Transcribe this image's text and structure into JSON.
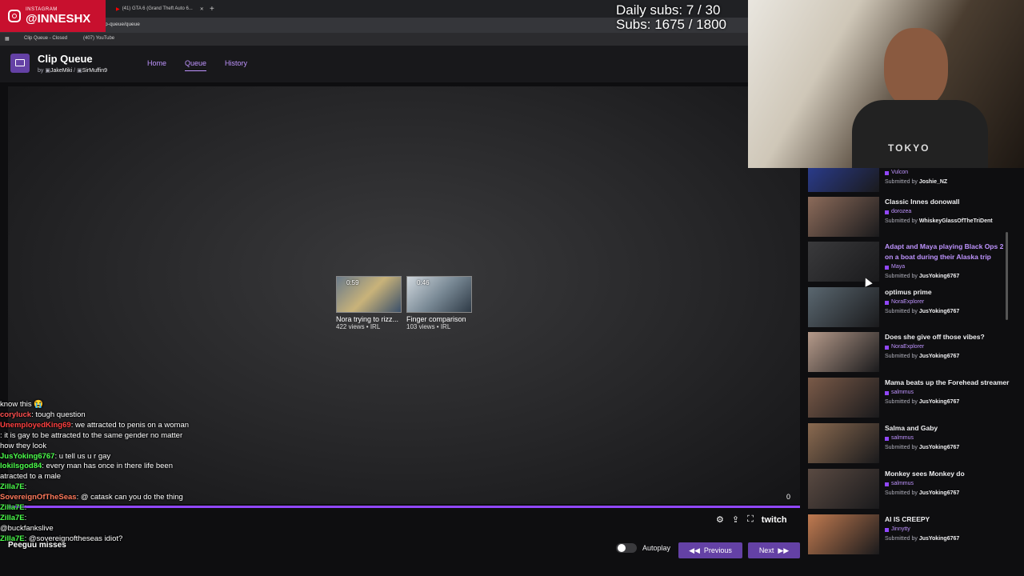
{
  "browser": {
    "tabs": [
      "(41) GTA 6 (Grand Theft Auto 6..."
    ],
    "url": "ch-clip-queue/queue",
    "bookmarks": [
      "Clip Queue - Closed",
      "(407) YouTube"
    ]
  },
  "instagram_badge": {
    "label": "INSTAGRAM",
    "handle": "@INNESHX"
  },
  "stream_stats": {
    "daily_subs": "Daily subs: 7 / 30",
    "subs": "Subs: 1675 / 1800"
  },
  "app": {
    "title": "Clip Queue",
    "by_label": "by",
    "authors": [
      "JakeMiki",
      "SirMuffin9"
    ],
    "nav": [
      "Home",
      "Queue",
      "History"
    ]
  },
  "player": {
    "related": [
      {
        "duration": "0:59",
        "title": "Nora trying to rizz...",
        "meta": "422 views • IRL"
      },
      {
        "duration": "0:46",
        "title": "Finger comparison",
        "meta": "103 views • IRL"
      }
    ],
    "count": "0",
    "progress": 1.0,
    "brand": "twitch",
    "autoplay_label": "Autoplay",
    "autoplay_on": false,
    "previous_label": "Previous",
    "next_label": "Next"
  },
  "chat": [
    {
      "user": "",
      "text": "know this 😭",
      "color": "#ffffff"
    },
    {
      "user": "coryluck",
      "text": ": tough question",
      "color": "#ff4f4f"
    },
    {
      "user": "UnemployedKing69",
      "text": ": we attracted to penis on a woman",
      "color": "#ff4040"
    },
    {
      "user": "",
      "text": ": it is gay to be attracted to the same gender no matter how they look",
      "color": "#3f6bff"
    },
    {
      "user": "JusYoking6767",
      "text": ": u tell us u r gay",
      "color": "#4cff4c"
    },
    {
      "user": "lokilsgod84",
      "text": ": every man has once in there life been atracted to a male",
      "color": "#4cff4c"
    },
    {
      "user": "Zilla7E",
      "text": ":",
      "color": "#4cff4c"
    },
    {
      "user": "SovereignOfTheSeas",
      "text": ": @ catask can you do the thing",
      "color": "#ff7a5c"
    },
    {
      "user": "Zilla7E",
      "text": ":",
      "color": "#4cff4c"
    },
    {
      "user": "Zilla7E",
      "text": ":",
      "color": "#4cff4c"
    },
    {
      "user": "",
      "text": "@buckfankslive",
      "color": "#ffffff"
    },
    {
      "user": "Zilla7E",
      "text": ": @sovereignoftheseas idiot?",
      "color": "#4cff4c"
    }
  ],
  "chat_extra": "Peeguu misses",
  "queue": [
    {
      "title": "",
      "author": "Vulcon",
      "submitted": "Joshie_NZ",
      "highlight": false,
      "thumb": "#2a3b8a"
    },
    {
      "title": "Classic Innes donowall",
      "author": "dorozea",
      "submitted": "WhiskeyGlassOfTheTriDent",
      "highlight": false,
      "thumb": "#8c6b5a"
    },
    {
      "title": "Adapt and Maya playing Black Ops 2 on a boat during their Alaska trip",
      "author": "Maya",
      "submitted": "JusYoking6767",
      "highlight": true,
      "thumb": "#3a3a3c"
    },
    {
      "title": "optimus prime",
      "author": "NoraExplorer",
      "submitted": "JusYoking6767",
      "highlight": false,
      "thumb": "#5a6770"
    },
    {
      "title": "Does she give off those vibes?",
      "author": "NoraExplorer",
      "submitted": "JusYoking6767",
      "highlight": false,
      "thumb": "#b59a8a"
    },
    {
      "title": "Mama beats up the Forehead streamer",
      "author": "salmmus",
      "submitted": "JusYoking6767",
      "highlight": false,
      "thumb": "#7a5a48"
    },
    {
      "title": "Salma and Gaby",
      "author": "salmmus",
      "submitted": "JusYoking6767",
      "highlight": false,
      "thumb": "#8a6a50"
    },
    {
      "title": "Monkey sees Monkey do",
      "author": "salmmus",
      "submitted": "JusYoking6767",
      "highlight": false,
      "thumb": "#5a4a42"
    },
    {
      "title": "AI IS CREEPY",
      "author": "Jinnytty",
      "submitted": "JusYoking6767",
      "highlight": false,
      "thumb": "#c07a50"
    }
  ],
  "submitted_prefix": "Submitted by",
  "webcam": {
    "shirt_text": "TOKYO"
  }
}
